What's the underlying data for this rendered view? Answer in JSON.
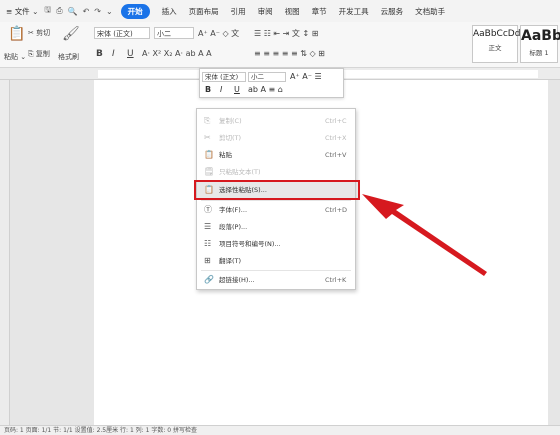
{
  "menubar": {
    "hamburger": "≡",
    "file": "文件",
    "undo": "↶",
    "redo": "↷",
    "tabs": [
      "开始",
      "插入",
      "页面布局",
      "引用",
      "审阅",
      "视图",
      "章节",
      "开发工具",
      "云服务",
      "文档助手"
    ]
  },
  "ribbon": {
    "paste": "粘贴",
    "cut": "剪切",
    "copy": "复制",
    "format_painter": "格式刷",
    "font_name": "宋体 (正文)",
    "font_size": "小二",
    "bold": "B",
    "italic": "I",
    "underline": "U",
    "style1_preview": "AaBbCcDd",
    "style1_name": "正文",
    "style2_preview": "AaBb",
    "style2_name": "标题 1"
  },
  "minitoolbar": {
    "font_name": "宋体 (正文)",
    "font_size": "小二",
    "bold": "B",
    "italic": "I",
    "underline": "U"
  },
  "context_menu": {
    "copy": {
      "label": "复制(C)",
      "shortcut": "Ctrl+C"
    },
    "cut": {
      "label": "剪切(T)",
      "shortcut": "Ctrl+X"
    },
    "paste": {
      "label": "粘贴",
      "shortcut": "Ctrl+V"
    },
    "paste_text": {
      "label": "只粘贴文本(T)"
    },
    "paste_special": {
      "label": "选择性粘贴(S)..."
    },
    "font": {
      "label": "字体(F)...",
      "shortcut": "Ctrl+D"
    },
    "paragraph": {
      "label": "段落(P)..."
    },
    "bullets": {
      "label": "项目符号和编号(N)..."
    },
    "translate": {
      "label": "翻译(T)"
    },
    "hyperlink": {
      "label": "超链接(H)...",
      "shortcut": "Ctrl+K"
    }
  },
  "statusbar": {
    "text": "页码: 1    页面: 1/1    节: 1/1    设置值: 2.5厘米    行: 1    列: 1    字数: 0    拼写检查"
  },
  "colors": {
    "accent": "#1a73e8",
    "highlight": "#d6191f"
  }
}
